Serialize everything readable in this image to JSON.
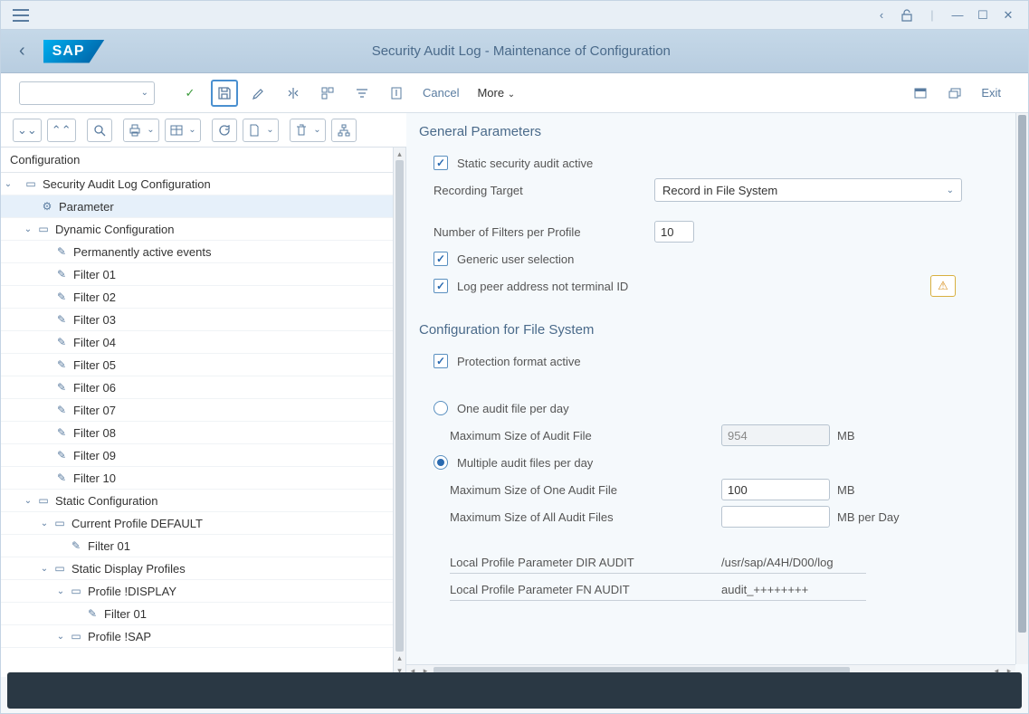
{
  "window": {
    "title": "Security Audit Log - Maintenance of Configuration"
  },
  "toolbar": {
    "cancel": "Cancel",
    "more": "More",
    "exit": "Exit",
    "combo_value": ""
  },
  "tree": {
    "header": "Configuration",
    "root": "Security Audit Log Configuration",
    "parameter": "Parameter",
    "dynamic": "Dynamic Configuration",
    "perm_active": "Permanently active events",
    "filters": [
      "Filter 01",
      "Filter 02",
      "Filter 03",
      "Filter 04",
      "Filter 05",
      "Filter 06",
      "Filter 07",
      "Filter 08",
      "Filter 09",
      "Filter 10"
    ],
    "static": "Static Configuration",
    "current_profile": "Current Profile DEFAULT",
    "cp_filter": "Filter 01",
    "static_display": "Static Display Profiles",
    "profile_display": "Profile !DISPLAY",
    "pd_filter": "Filter 01",
    "profile_sap": "Profile !SAP"
  },
  "general": {
    "title": "General Parameters",
    "static_active": "Static security audit active",
    "recording_target_lbl": "Recording Target",
    "recording_target_val": "Record in File System",
    "num_filters_lbl": "Number of Filters per Profile",
    "num_filters_val": "10",
    "generic_user": "Generic user selection",
    "log_peer": "Log peer address not terminal ID"
  },
  "filesys": {
    "title": "Configuration for File System",
    "protection": "Protection format active",
    "one_per_day": "One audit file per day",
    "max_audit_lbl": "Maximum Size of Audit File",
    "max_audit_val": "954",
    "mb": "MB",
    "multiple_per_day": "Multiple audit files per day",
    "max_one_lbl": "Maximum Size of One Audit File",
    "max_one_val": "100",
    "max_all_lbl": "Maximum Size of All Audit Files",
    "max_all_val": "",
    "mb_day": "MB per Day",
    "dir_audit_lbl": "Local Profile Parameter DIR AUDIT",
    "dir_audit_val": "/usr/sap/A4H/D00/log",
    "fn_audit_lbl": "Local Profile Parameter FN AUDIT",
    "fn_audit_val": "audit_++++++++"
  }
}
